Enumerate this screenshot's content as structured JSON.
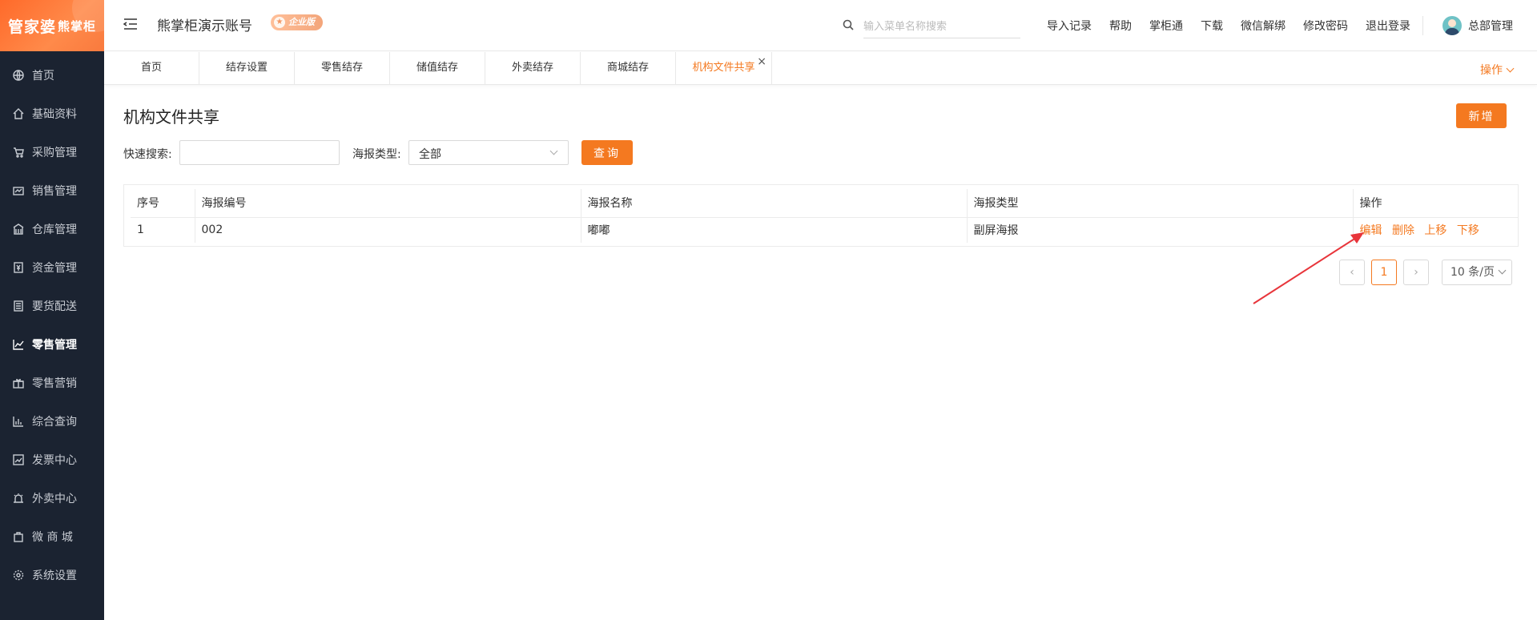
{
  "brand": {
    "logo_text": "管家婆",
    "logo_text_b": "熊掌柜"
  },
  "sidebar": {
    "items": [
      {
        "label": "首页",
        "icon": "globe-icon"
      },
      {
        "label": "基础资料",
        "icon": "home-icon"
      },
      {
        "label": "采购管理",
        "icon": "cart-icon"
      },
      {
        "label": "销售管理",
        "icon": "sales-icon"
      },
      {
        "label": "仓库管理",
        "icon": "warehouse-icon"
      },
      {
        "label": "资金管理",
        "icon": "money-icon"
      },
      {
        "label": "要货配送",
        "icon": "list-icon"
      },
      {
        "label": "零售管理",
        "icon": "chart-icon",
        "active": true
      },
      {
        "label": "零售营销",
        "icon": "gift-icon"
      },
      {
        "label": "综合查询",
        "icon": "bar-chart-icon"
      },
      {
        "label": "发票中心",
        "icon": "trend-icon"
      },
      {
        "label": "外卖中心",
        "icon": "alarm-icon"
      },
      {
        "label": "微 商 城",
        "icon": "bag-icon"
      },
      {
        "label": "系统设置",
        "icon": "gear-icon"
      }
    ]
  },
  "header": {
    "account_name": "熊掌柜演示账号",
    "edition": "企业版",
    "search_placeholder": "输入菜单名称搜索",
    "links": [
      "导入记录",
      "帮助",
      "掌柜通",
      "下载",
      "微信解绑",
      "修改密码",
      "退出登录"
    ],
    "user_name": "总部管理"
  },
  "tabs": {
    "items": [
      "首页",
      "结存设置",
      "零售结存",
      "储值结存",
      "外卖结存",
      "商城结存",
      "机构文件共享"
    ],
    "active_index": 6,
    "close_glyph": "×",
    "ops_label": "操作"
  },
  "page": {
    "title": "机构文件共享",
    "add_label": "新增",
    "quick_search_label": "快速搜索:",
    "quick_search_value": "",
    "poster_type_label": "海报类型:",
    "poster_type_value": "全部",
    "query_label": "查询"
  },
  "table": {
    "headers": [
      "序号",
      "海报编号",
      "海报名称",
      "海报类型",
      "操作"
    ],
    "rows": [
      {
        "index": "1",
        "code": "002",
        "name": "嘟嘟",
        "type": "副屏海报"
      }
    ],
    "actions": [
      "编辑",
      "删除",
      "上移",
      "下移"
    ]
  },
  "pagination": {
    "prev": "‹",
    "current": "1",
    "next": "›",
    "page_size": "10 条/页"
  },
  "colors": {
    "accent": "#f47920",
    "sidebar_bg": "#1b2331",
    "annotation_arrow": "#e8353b"
  }
}
